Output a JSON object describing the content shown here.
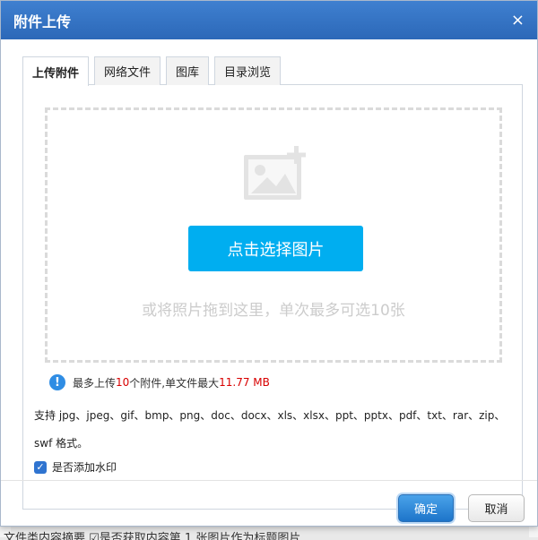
{
  "dialog": {
    "title": "附件上传",
    "close_label": "×"
  },
  "tabs": [
    {
      "label": "上传附件",
      "active": true
    },
    {
      "label": "网络文件",
      "active": false
    },
    {
      "label": "图库",
      "active": false
    },
    {
      "label": "目录浏览",
      "active": false
    }
  ],
  "upload": {
    "choose_button_label": "点击选择图片",
    "drop_hint": "或将照片拖到这里，单次最多可选10张",
    "limit_prefix": "最多上传 ",
    "max_count": "10",
    "limit_middle": " 个附件,单文件最大 ",
    "max_size": "11.77 MB",
    "formats_text": "支持 jpg、jpeg、gif、bmp、png、doc、docx、xls、xlsx、ppt、pptx、pdf、txt、rar、zip、swf 格式。",
    "watermark_label": "是否添加水印",
    "watermark_checked": true
  },
  "buttons": {
    "ok_label": "确定",
    "cancel_label": "取消"
  },
  "colors": {
    "titlebar": "#2c68b8",
    "primary_button": "#00aef0",
    "highlight_red": "#d80000"
  },
  "background": {
    "partial_text": "文件类内容摘要 ☑是否获取内容第 1 张图片作为标题图片"
  }
}
